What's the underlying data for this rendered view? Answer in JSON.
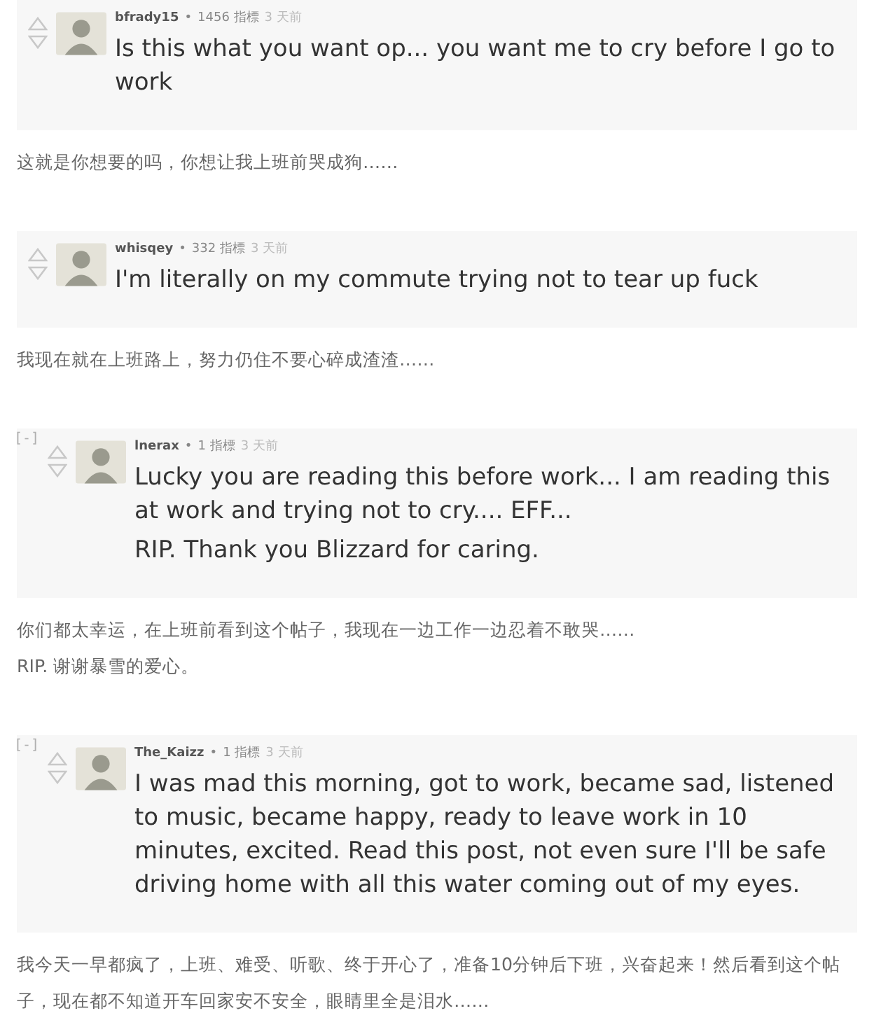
{
  "entries": [
    {
      "comment": {
        "user": "bfrady15",
        "separator": "•",
        "points": "1456 指標",
        "time": "3 天前",
        "paragraphs": [
          "Is this what you want op... you want me to cry before I go to work"
        ]
      },
      "translation": [
        "这就是你想要的吗，你想让我上班前哭成狗……"
      ]
    },
    {
      "comment": {
        "user": "whisqey",
        "separator": "•",
        "points": "332 指標",
        "time": "3 天前",
        "paragraphs": [
          "I'm literally on my commute trying not to tear up fuck"
        ]
      },
      "translation": [
        "我现在就在上班路上，努力仍住不要心碎成渣渣……"
      ]
    },
    {
      "comment": {
        "collapse": "[-]",
        "user": "lnerax",
        "separator": "•",
        "points": "1 指標",
        "time": "3 天前",
        "paragraphs": [
          "Lucky you are reading this before work... I am reading this at work and trying not to cry.... EFF...",
          "RIP. Thank you Blizzard for caring."
        ]
      },
      "translation": [
        "你们都太幸运，在上班前看到这个帖子，我现在一边工作一边忍着不敢哭……",
        "RIP. 谢谢暴雪的爱心。"
      ]
    },
    {
      "comment": {
        "collapse": "[-]",
        "user": "The_Kaizz",
        "separator": "•",
        "points": "1 指標",
        "time": "3 天前",
        "paragraphs": [
          "I was mad this morning, got to work, became sad, listened to music, became happy, ready to leave work in 10 minutes, excited. Read this post, not even sure I'll be safe driving home with all this water coming out of my eyes."
        ]
      },
      "translation": [
        "我今天一早都疯了，上班、难受、听歌、终于开心了，准备10分钟后下班，兴奋起来！然后看到这个帖子，现在都不知道开车回家安不安全，眼睛里全是泪水……"
      ]
    }
  ]
}
